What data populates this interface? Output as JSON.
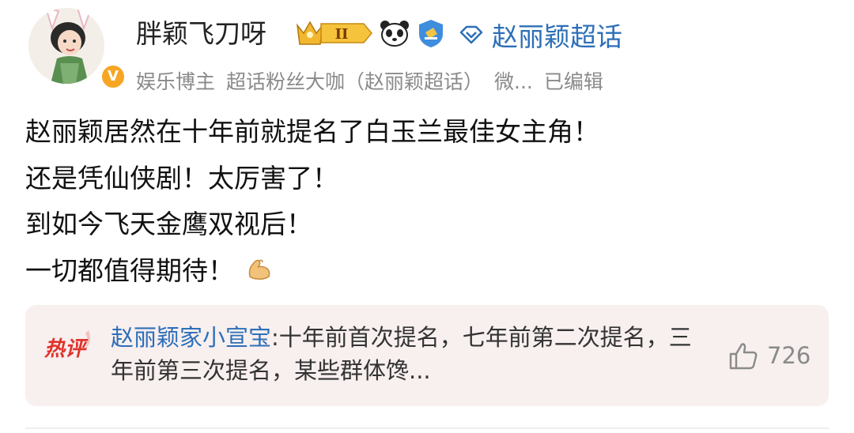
{
  "post": {
    "username": "胖颖飞刀呀",
    "vip_badge_text": "II",
    "supertopic_name": "赵丽颖超话",
    "meta": {
      "role1": "娱乐博主",
      "role2": "超话粉丝大咖（赵丽颖超话）",
      "source": "微...",
      "edited": "已编辑"
    },
    "lines": [
      "赵丽颖居然在十年前就提名了白玉兰最佳女主角！",
      "还是凭仙侠剧！太厉害了！",
      "到如今飞天金鹰双视后！",
      "一切都值得期待！"
    ]
  },
  "hot_comment": {
    "label": "热评",
    "author": "赵丽颖家小宣宝",
    "separator": ":",
    "text": "十年前首次提名，七年前第二次提名，三年前第三次提名，某些群体馋...",
    "likes": "726"
  },
  "colors": {
    "link_blue": "#2d6fb8",
    "meta_gray": "#8a8a8a",
    "hot_bg": "#f8efef",
    "hot_label_red": "#e0322b",
    "verify_orange": "#f6a623"
  }
}
